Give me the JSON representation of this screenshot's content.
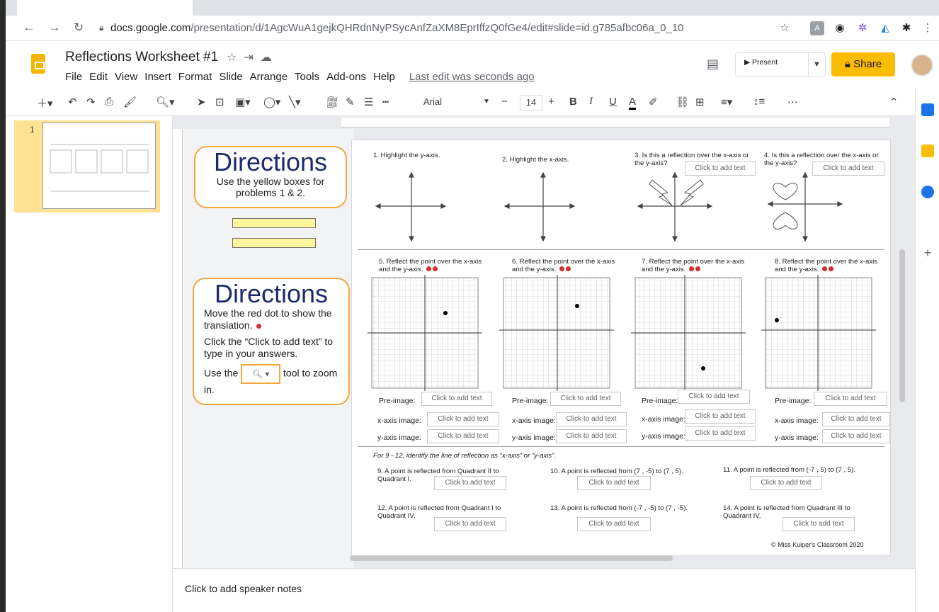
{
  "browser": {
    "url_domain": "docs.google.com",
    "url_path": "/presentation/d/1AgcWuA1gejkQHRdnNyPSycAnfZaXM8EprIffzQ0fGe4/edit#slide=id.g785afbc06a_0_10"
  },
  "app": {
    "title": "Reflections Worksheet #1",
    "menu": [
      "File",
      "Edit",
      "View",
      "Insert",
      "Format",
      "Slide",
      "Arrange",
      "Tools",
      "Add-ons",
      "Help"
    ],
    "last_edit": "Last edit was seconds ago",
    "present_label": "Present",
    "share_label": "Share"
  },
  "toolbar": {
    "font": "Arial",
    "font_size": "14"
  },
  "filmstrip": {
    "slide_number": "1"
  },
  "slide": {
    "directions1": {
      "heading": "Directions",
      "text": "Use the yellow boxes for problems 1 & 2."
    },
    "directions2": {
      "heading": "Directions",
      "line1": "Move the red dot to show the translation.",
      "line2": "Click the “Click to add text” to type in your answers.",
      "line3a": "Use the",
      "line3b": "tool to zoom in."
    },
    "q1": "1. Highlight the y-axis.",
    "q2": "2. Highlight the x-axis.",
    "q3": "3. Is this a reflection over the x-axis or the y-axis?",
    "q4": "4. Is this a reflection over the x-axis or the y-axis?",
    "q5": "5. Reflect the point over the x-axis and the y-axis.",
    "q6": "6. Reflect the point over the x-axis and the y-axis.",
    "q7": "7. Reflect the point over the x-axis and the y-axis.",
    "q8": "8. Reflect the point over the x-axis and the y-axis.",
    "placeholder": "Click to add text",
    "pre_image": "Pre-image:",
    "x_image": "x-axis image:",
    "y_image": "y-axis image:",
    "instruction": "For 9 - 12, identify the line of reflection as “x-axis” or “y-axis”.",
    "q9": "9. A point is reflected from Quadrant II to Quadrant I.",
    "q10": "10. A point is reflected from (7 , -5) to (7 , 5).",
    "q11": "11. A point is reflected from (-7 , 5) to (7 , 5).",
    "q12": "12. A point is reflected from Quadrant I to Quadrant IV.",
    "q13": "13. A point is reflected from (-7 , -5) to (7 , -5).",
    "q14": "14. A point is reflected from Quadrant III to Quadrant IV.",
    "copyright": "© Miss Kuiper's Classroom 2020"
  },
  "notes": {
    "placeholder": "Click to add speaker notes"
  }
}
